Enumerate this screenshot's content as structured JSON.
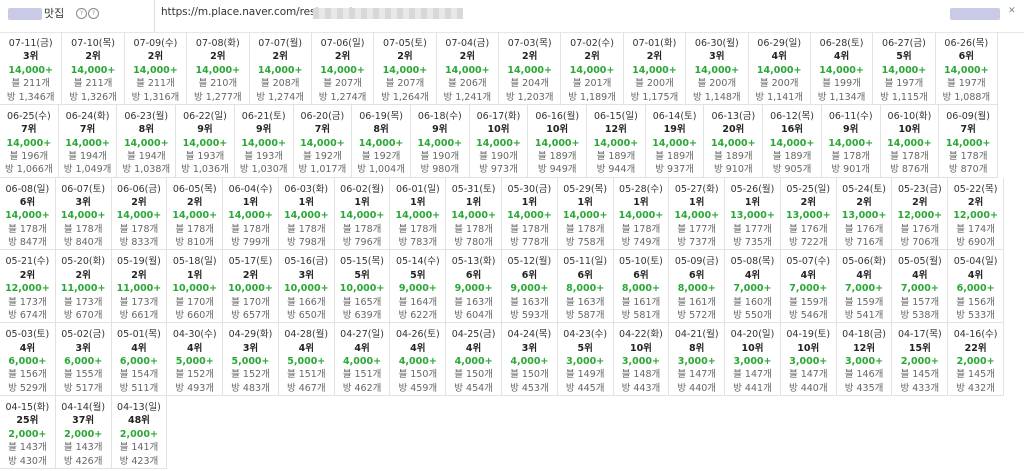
{
  "header": {
    "label": "맛집",
    "icon_left": "circle-icon",
    "url": "https://m.place.naver.com/restaurant"
  },
  "rows": [
    [
      {
        "date": "07-11(금)",
        "rank": "3위",
        "visits": "14,000+",
        "blog": "블 211개",
        "room": "방 1,346개"
      },
      {
        "date": "07-10(목)",
        "rank": "2위",
        "visits": "14,000+",
        "blog": "블 211개",
        "room": "방 1,326개"
      },
      {
        "date": "07-09(수)",
        "rank": "2위",
        "visits": "14,000+",
        "blog": "블 211개",
        "room": "방 1,316개"
      },
      {
        "date": "07-08(화)",
        "rank": "2위",
        "visits": "14,000+",
        "blog": "블 210개",
        "room": "방 1,277개"
      },
      {
        "date": "07-07(월)",
        "rank": "2위",
        "visits": "14,000+",
        "blog": "블 208개",
        "room": "방 1,274개"
      },
      {
        "date": "07-06(일)",
        "rank": "2위",
        "visits": "14,000+",
        "blog": "블 207개",
        "room": "방 1,274개"
      },
      {
        "date": "07-05(토)",
        "rank": "2위",
        "visits": "14,000+",
        "blog": "블 207개",
        "room": "방 1,264개"
      },
      {
        "date": "07-04(금)",
        "rank": "2위",
        "visits": "14,000+",
        "blog": "블 206개",
        "room": "방 1,241개"
      },
      {
        "date": "07-03(목)",
        "rank": "2위",
        "visits": "14,000+",
        "blog": "블 204개",
        "room": "방 1,203개"
      },
      {
        "date": "07-02(수)",
        "rank": "2위",
        "visits": "14,000+",
        "blog": "블 201개",
        "room": "방 1,189개"
      },
      {
        "date": "07-01(화)",
        "rank": "2위",
        "visits": "14,000+",
        "blog": "블 200개",
        "room": "방 1,175개"
      },
      {
        "date": "06-30(월)",
        "rank": "3위",
        "visits": "14,000+",
        "blog": "블 200개",
        "room": "방 1,148개"
      },
      {
        "date": "06-29(일)",
        "rank": "4위",
        "visits": "14,000+",
        "blog": "블 200개",
        "room": "방 1,141개"
      },
      {
        "date": "06-28(토)",
        "rank": "4위",
        "visits": "14,000+",
        "blog": "블 199개",
        "room": "방 1,134개"
      },
      {
        "date": "06-27(금)",
        "rank": "5위",
        "visits": "14,000+",
        "blog": "블 197개",
        "room": "방 1,115개"
      },
      {
        "date": "06-26(목)",
        "rank": "6위",
        "visits": "14,000+",
        "blog": "블 197개",
        "room": "방 1,088개"
      }
    ],
    [
      {
        "date": "06-25(수)",
        "rank": "7위",
        "visits": "14,000+",
        "blog": "블 196개",
        "room": "방 1,066개"
      },
      {
        "date": "06-24(화)",
        "rank": "7위",
        "visits": "14,000+",
        "blog": "블 194개",
        "room": "방 1,049개"
      },
      {
        "date": "06-23(월)",
        "rank": "8위",
        "visits": "14,000+",
        "blog": "블 194개",
        "room": "방 1,038개"
      },
      {
        "date": "06-22(일)",
        "rank": "9위",
        "visits": "14,000+",
        "blog": "블 193개",
        "room": "방 1,036개"
      },
      {
        "date": "06-21(토)",
        "rank": "9위",
        "visits": "14,000+",
        "blog": "블 193개",
        "room": "방 1,030개"
      },
      {
        "date": "06-20(금)",
        "rank": "7위",
        "visits": "14,000+",
        "blog": "블 192개",
        "room": "방 1,017개"
      },
      {
        "date": "06-19(목)",
        "rank": "8위",
        "visits": "14,000+",
        "blog": "블 192개",
        "room": "방 1,004개"
      },
      {
        "date": "06-18(수)",
        "rank": "9위",
        "visits": "14,000+",
        "blog": "블 190개",
        "room": "방 980개"
      },
      {
        "date": "06-17(화)",
        "rank": "10위",
        "visits": "14,000+",
        "blog": "블 190개",
        "room": "방 973개"
      },
      {
        "date": "06-16(월)",
        "rank": "10위",
        "visits": "14,000+",
        "blog": "블 189개",
        "room": "방 949개"
      },
      {
        "date": "06-15(일)",
        "rank": "12위",
        "visits": "14,000+",
        "blog": "블 189개",
        "room": "방 944개"
      },
      {
        "date": "06-14(토)",
        "rank": "19위",
        "visits": "14,000+",
        "blog": "블 189개",
        "room": "방 937개"
      },
      {
        "date": "06-13(금)",
        "rank": "20위",
        "visits": "14,000+",
        "blog": "블 189개",
        "room": "방 910개"
      },
      {
        "date": "06-12(목)",
        "rank": "16위",
        "visits": "14,000+",
        "blog": "블 189개",
        "room": "방 905개"
      },
      {
        "date": "06-11(수)",
        "rank": "9위",
        "visits": "14,000+",
        "blog": "블 178개",
        "room": "방 901개"
      },
      {
        "date": "06-10(화)",
        "rank": "10위",
        "visits": "14,000+",
        "blog": "블 178개",
        "room": "방 876개"
      },
      {
        "date": "06-09(월)",
        "rank": "7위",
        "visits": "14,000+",
        "blog": "블 178개",
        "room": "방 870개"
      }
    ],
    [
      {
        "date": "06-08(일)",
        "rank": "6위",
        "visits": "14,000+",
        "blog": "블 178개",
        "room": "방 847개"
      },
      {
        "date": "06-07(토)",
        "rank": "3위",
        "visits": "14,000+",
        "blog": "블 178개",
        "room": "방 840개"
      },
      {
        "date": "06-06(금)",
        "rank": "2위",
        "visits": "14,000+",
        "blog": "블 178개",
        "room": "방 833개"
      },
      {
        "date": "06-05(목)",
        "rank": "2위",
        "visits": "14,000+",
        "blog": "블 178개",
        "room": "방 810개"
      },
      {
        "date": "06-04(수)",
        "rank": "1위",
        "visits": "14,000+",
        "blog": "블 178개",
        "room": "방 799개"
      },
      {
        "date": "06-03(화)",
        "rank": "1위",
        "visits": "14,000+",
        "blog": "블 178개",
        "room": "방 798개"
      },
      {
        "date": "06-02(월)",
        "rank": "1위",
        "visits": "14,000+",
        "blog": "블 178개",
        "room": "방 796개"
      },
      {
        "date": "06-01(일)",
        "rank": "1위",
        "visits": "14,000+",
        "blog": "블 178개",
        "room": "방 783개"
      },
      {
        "date": "05-31(토)",
        "rank": "1위",
        "visits": "14,000+",
        "blog": "블 178개",
        "room": "방 780개"
      },
      {
        "date": "05-30(금)",
        "rank": "1위",
        "visits": "14,000+",
        "blog": "블 178개",
        "room": "방 778개"
      },
      {
        "date": "05-29(목)",
        "rank": "1위",
        "visits": "14,000+",
        "blog": "블 178개",
        "room": "방 758개"
      },
      {
        "date": "05-28(수)",
        "rank": "1위",
        "visits": "14,000+",
        "blog": "블 178개",
        "room": "방 749개"
      },
      {
        "date": "05-27(화)",
        "rank": "1위",
        "visits": "14,000+",
        "blog": "블 177개",
        "room": "방 737개"
      },
      {
        "date": "05-26(월)",
        "rank": "1위",
        "visits": "13,000+",
        "blog": "블 177개",
        "room": "방 735개"
      },
      {
        "date": "05-25(일)",
        "rank": "2위",
        "visits": "13,000+",
        "blog": "블 176개",
        "room": "방 722개"
      },
      {
        "date": "05-24(토)",
        "rank": "2위",
        "visits": "13,000+",
        "blog": "블 176개",
        "room": "방 716개"
      },
      {
        "date": "05-23(금)",
        "rank": "2위",
        "visits": "12,000+",
        "blog": "블 176개",
        "room": "방 706개"
      },
      {
        "date": "05-22(목)",
        "rank": "2위",
        "visits": "12,000+",
        "blog": "블 174개",
        "room": "방 690개"
      }
    ],
    [
      {
        "date": "05-21(수)",
        "rank": "2위",
        "visits": "12,000+",
        "blog": "블 173개",
        "room": "방 674개"
      },
      {
        "date": "05-20(화)",
        "rank": "2위",
        "visits": "11,000+",
        "blog": "블 173개",
        "room": "방 670개"
      },
      {
        "date": "05-19(월)",
        "rank": "2위",
        "visits": "11,000+",
        "blog": "블 173개",
        "room": "방 661개"
      },
      {
        "date": "05-18(일)",
        "rank": "1위",
        "visits": "10,000+",
        "blog": "블 170개",
        "room": "방 660개"
      },
      {
        "date": "05-17(토)",
        "rank": "2위",
        "visits": "10,000+",
        "blog": "블 170개",
        "room": "방 657개"
      },
      {
        "date": "05-16(금)",
        "rank": "3위",
        "visits": "10,000+",
        "blog": "블 166개",
        "room": "방 650개"
      },
      {
        "date": "05-15(목)",
        "rank": "5위",
        "visits": "10,000+",
        "blog": "블 165개",
        "room": "방 639개"
      },
      {
        "date": "05-14(수)",
        "rank": "5위",
        "visits": "9,000+",
        "blog": "블 164개",
        "room": "방 622개"
      },
      {
        "date": "05-13(화)",
        "rank": "6위",
        "visits": "9,000+",
        "blog": "블 163개",
        "room": "방 604개"
      },
      {
        "date": "05-12(월)",
        "rank": "6위",
        "visits": "9,000+",
        "blog": "블 163개",
        "room": "방 593개"
      },
      {
        "date": "05-11(일)",
        "rank": "6위",
        "visits": "8,000+",
        "blog": "블 163개",
        "room": "방 587개"
      },
      {
        "date": "05-10(토)",
        "rank": "6위",
        "visits": "8,000+",
        "blog": "블 161개",
        "room": "방 581개"
      },
      {
        "date": "05-09(금)",
        "rank": "6위",
        "visits": "8,000+",
        "blog": "블 161개",
        "room": "방 572개"
      },
      {
        "date": "05-08(목)",
        "rank": "4위",
        "visits": "7,000+",
        "blog": "블 160개",
        "room": "방 550개"
      },
      {
        "date": "05-07(수)",
        "rank": "4위",
        "visits": "7,000+",
        "blog": "블 159개",
        "room": "방 546개"
      },
      {
        "date": "05-06(화)",
        "rank": "4위",
        "visits": "7,000+",
        "blog": "블 159개",
        "room": "방 541개"
      },
      {
        "date": "05-05(월)",
        "rank": "4위",
        "visits": "7,000+",
        "blog": "블 157개",
        "room": "방 538개"
      },
      {
        "date": "05-04(일)",
        "rank": "4위",
        "visits": "6,000+",
        "blog": "블 156개",
        "room": "방 533개"
      }
    ],
    [
      {
        "date": "05-03(토)",
        "rank": "4위",
        "visits": "6,000+",
        "blog": "블 156개",
        "room": "방 529개"
      },
      {
        "date": "05-02(금)",
        "rank": "3위",
        "visits": "6,000+",
        "blog": "블 155개",
        "room": "방 517개"
      },
      {
        "date": "05-01(목)",
        "rank": "4위",
        "visits": "6,000+",
        "blog": "블 154개",
        "room": "방 511개"
      },
      {
        "date": "04-30(수)",
        "rank": "4위",
        "visits": "5,000+",
        "blog": "블 152개",
        "room": "방 493개"
      },
      {
        "date": "04-29(화)",
        "rank": "3위",
        "visits": "5,000+",
        "blog": "블 152개",
        "room": "방 483개"
      },
      {
        "date": "04-28(월)",
        "rank": "4위",
        "visits": "5,000+",
        "blog": "블 151개",
        "room": "방 467개"
      },
      {
        "date": "04-27(일)",
        "rank": "4위",
        "visits": "4,000+",
        "blog": "블 151개",
        "room": "방 462개"
      },
      {
        "date": "04-26(토)",
        "rank": "4위",
        "visits": "4,000+",
        "blog": "블 150개",
        "room": "방 459개"
      },
      {
        "date": "04-25(금)",
        "rank": "4위",
        "visits": "4,000+",
        "blog": "블 150개",
        "room": "방 454개"
      },
      {
        "date": "04-24(목)",
        "rank": "3위",
        "visits": "4,000+",
        "blog": "블 150개",
        "room": "방 453개"
      },
      {
        "date": "04-23(수)",
        "rank": "5위",
        "visits": "3,000+",
        "blog": "블 149개",
        "room": "방 445개"
      },
      {
        "date": "04-22(화)",
        "rank": "10위",
        "visits": "3,000+",
        "blog": "블 148개",
        "room": "방 443개"
      },
      {
        "date": "04-21(월)",
        "rank": "8위",
        "visits": "3,000+",
        "blog": "블 147개",
        "room": "방 440개"
      },
      {
        "date": "04-20(일)",
        "rank": "10위",
        "visits": "3,000+",
        "blog": "블 147개",
        "room": "방 441개"
      },
      {
        "date": "04-19(토)",
        "rank": "10위",
        "visits": "3,000+",
        "blog": "블 147개",
        "room": "방 440개"
      },
      {
        "date": "04-18(금)",
        "rank": "12위",
        "visits": "3,000+",
        "blog": "블 146개",
        "room": "방 435개"
      },
      {
        "date": "04-17(목)",
        "rank": "15위",
        "visits": "2,000+",
        "blog": "블 145개",
        "room": "방 433개"
      },
      {
        "date": "04-16(수)",
        "rank": "22위",
        "visits": "2,000+",
        "blog": "블 145개",
        "room": "방 432개"
      }
    ],
    [
      {
        "date": "04-15(화)",
        "rank": "25위",
        "visits": "2,000+",
        "blog": "블 143개",
        "room": "방 430개"
      },
      {
        "date": "04-14(월)",
        "rank": "37위",
        "visits": "2,000+",
        "blog": "블 143개",
        "room": "방 426개"
      },
      {
        "date": "04-13(일)",
        "rank": "48위",
        "visits": "2,000+",
        "blog": "블 141개",
        "room": "방 423개"
      }
    ]
  ]
}
